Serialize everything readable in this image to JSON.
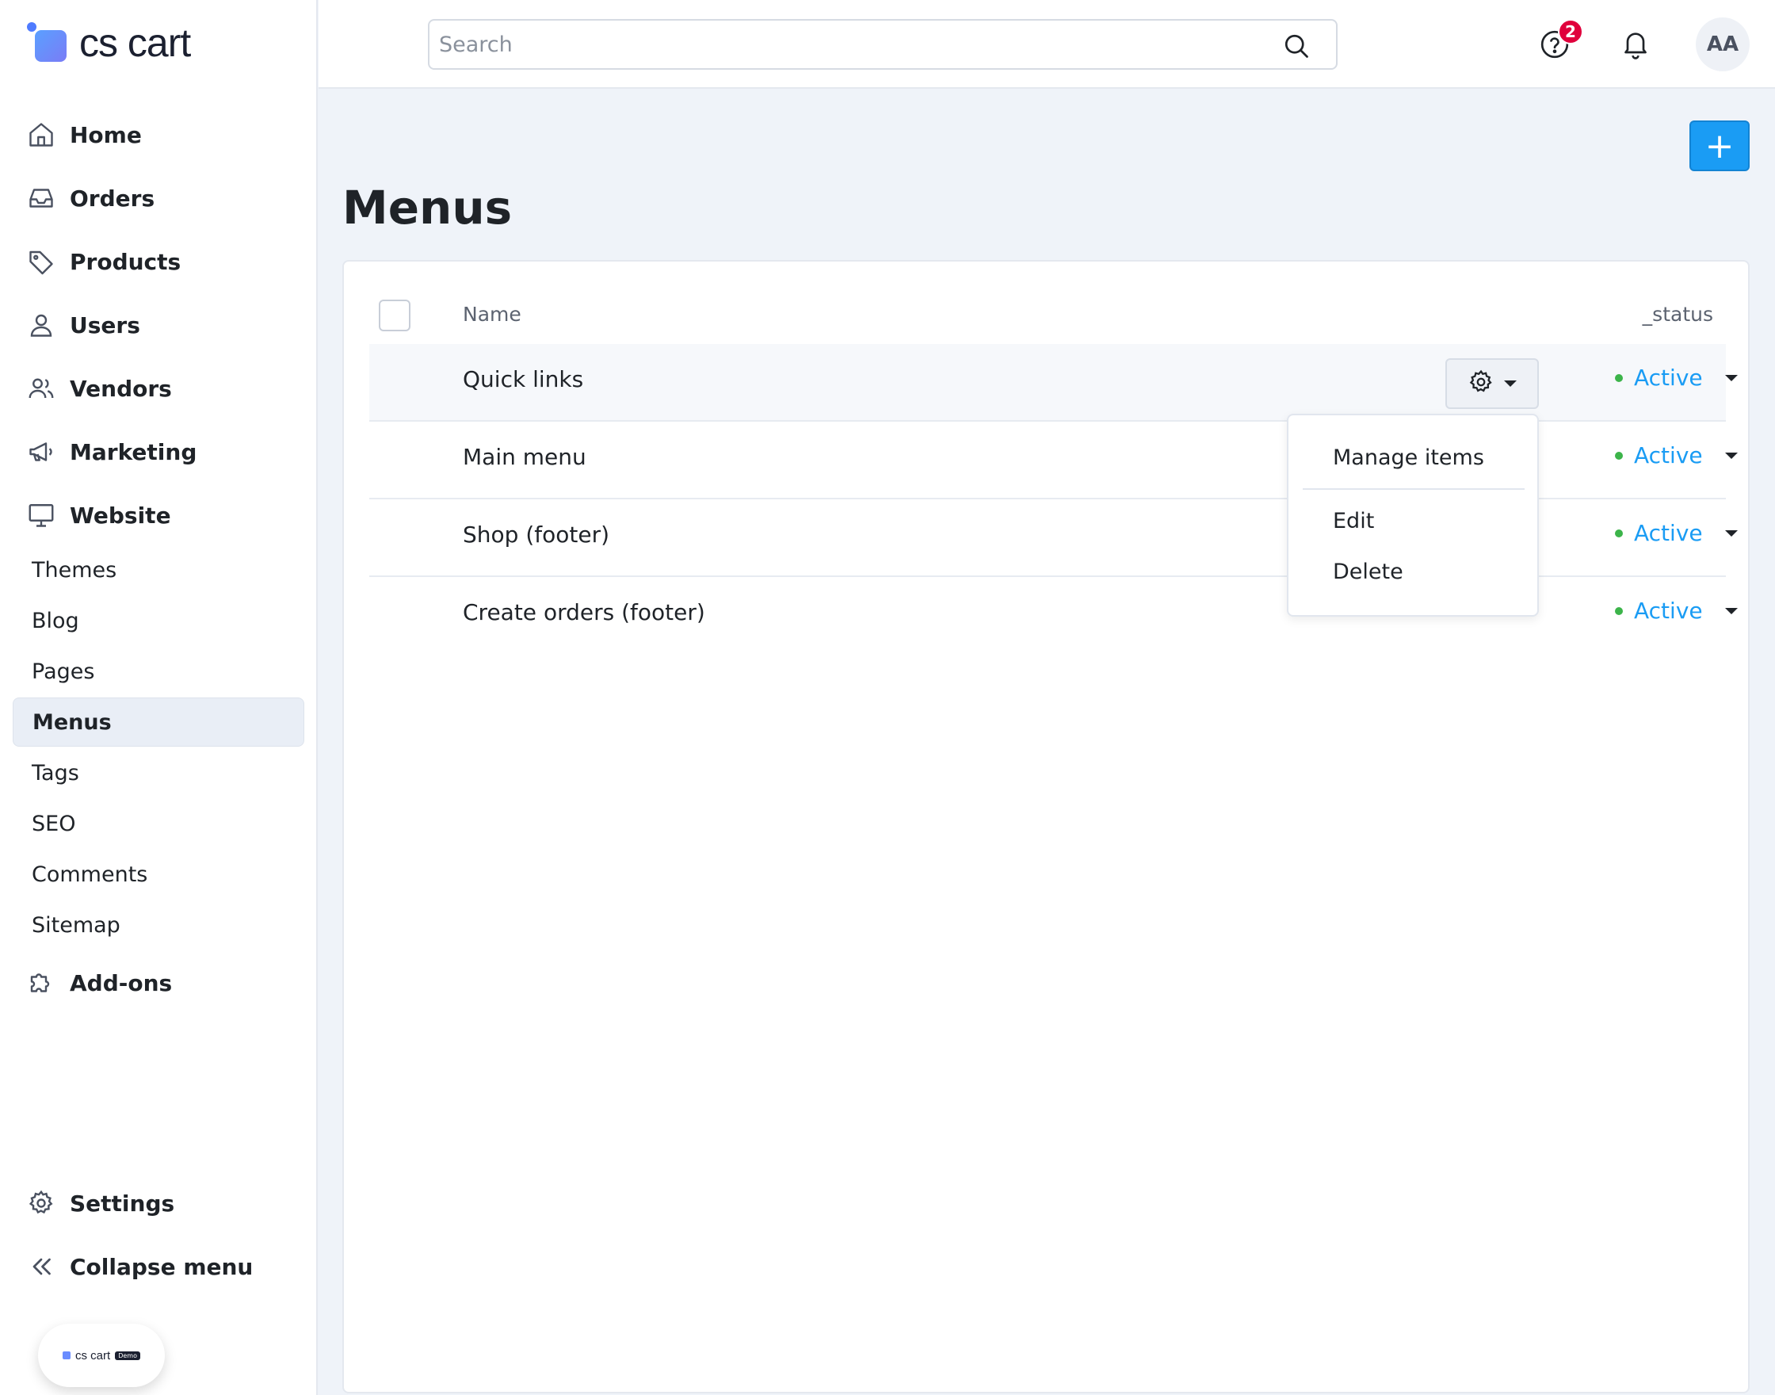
{
  "brand": {
    "logo_text": "cs cart",
    "demo_text": "cs cart",
    "demo_tag": "Demo"
  },
  "search": {
    "placeholder": "Search"
  },
  "topbar": {
    "help_badge_count": "2",
    "avatar_initials": "AA"
  },
  "sidebar": {
    "primary_top": [
      {
        "label": "Home",
        "icon": "home-icon"
      },
      {
        "label": "Orders",
        "icon": "inbox-icon"
      },
      {
        "label": "Products",
        "icon": "tag-icon"
      },
      {
        "label": "Users",
        "icon": "user-icon"
      },
      {
        "label": "Vendors",
        "icon": "users-icon"
      },
      {
        "label": "Marketing",
        "icon": "megaphone-icon"
      },
      {
        "label": "Website",
        "icon": "monitor-icon"
      }
    ],
    "website_sub": [
      "Themes",
      "Blog",
      "Pages",
      "Menus",
      "Tags",
      "SEO",
      "Comments",
      "Sitemap"
    ],
    "active_sub": "Menus",
    "addons": {
      "label": "Add-ons",
      "icon": "puzzle-icon"
    },
    "settings": {
      "label": "Settings",
      "icon": "gear-icon"
    },
    "collapse": {
      "label": "Collapse menu",
      "icon": "double-chevron-left-icon"
    }
  },
  "page": {
    "title": "Menus",
    "add_button": "+"
  },
  "table": {
    "columns": {
      "name": "Name",
      "status": "_status"
    },
    "rows": [
      {
        "name": "Quick links",
        "status": "Active"
      },
      {
        "name": "Main menu",
        "status": "Active"
      },
      {
        "name": "Shop (footer)",
        "status": "Active"
      },
      {
        "name": "Create orders (footer)",
        "status": "Active"
      }
    ]
  },
  "row_actions_menu": {
    "items": [
      "Manage items",
      "Edit",
      "Delete"
    ]
  },
  "colors": {
    "accent": "#1a9cf4",
    "status_active_dot": "#3cb44a",
    "badge": "#e0003c",
    "page_bg": "#eff3f9"
  }
}
